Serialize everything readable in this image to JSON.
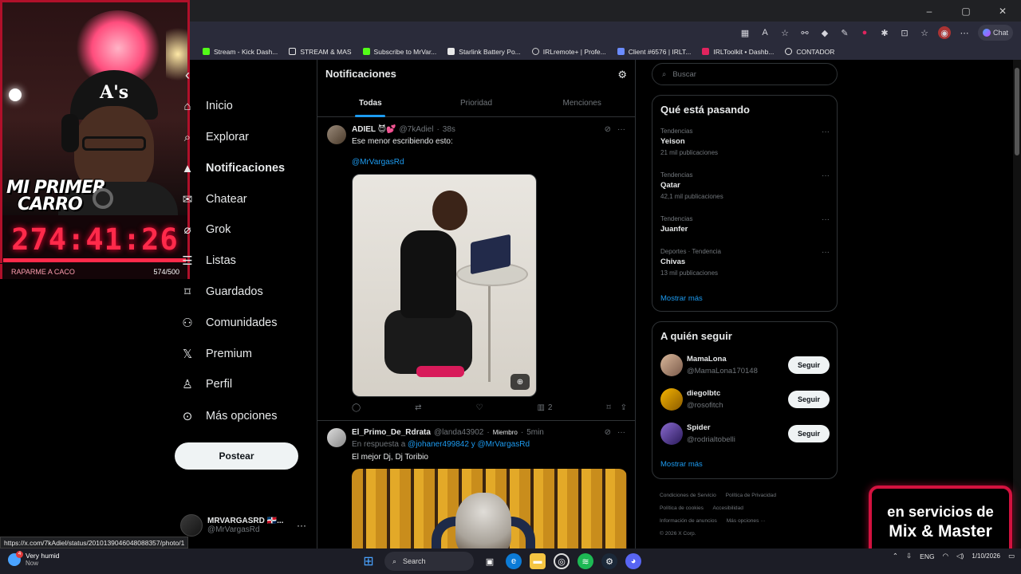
{
  "browser": {
    "window_controls": [
      "–",
      "▢",
      "✕"
    ],
    "chat_label": "Chat",
    "bookmarks": [
      {
        "label": "Stream - Kick Dash...",
        "color": "#53fc18"
      },
      {
        "label": "STREAM & MAS",
        "color": "#e8e8e8"
      },
      {
        "label": "Subscribe to MrVar...",
        "color": "#53fc18"
      },
      {
        "label": "Starlink Battery Po...",
        "color": "#e8e8e8"
      },
      {
        "label": "IRLremote+ | Profe...",
        "color": "#cfcfcf"
      },
      {
        "label": "Client #6576 | IRLT...",
        "color": "#6b8cff"
      },
      {
        "label": "IRLToolkit • Dashb...",
        "color": "#e0245e"
      },
      {
        "label": "CONTADOR",
        "color": "#e8e8e8"
      }
    ],
    "status_url": "https://x.com/7kAdiel/status/2010139046048088357/photo/1"
  },
  "stream_overlay": {
    "title_line1": "MI PRIMER",
    "title_line2": "CARRO",
    "timer": "274:41:26",
    "progress": 0.995,
    "goal_label": "RAPARME A CACO",
    "goal_count": "574/500"
  },
  "nav": {
    "items": [
      {
        "label": "Inicio",
        "icon": "home-icon",
        "active": false
      },
      {
        "label": "Explorar",
        "icon": "search-icon",
        "active": false
      },
      {
        "label": "Notificaciones",
        "icon": "bell-icon",
        "active": true
      },
      {
        "label": "Chatear",
        "icon": "envelope-icon",
        "active": false
      },
      {
        "label": "Grok",
        "icon": "grok-icon",
        "active": false
      },
      {
        "label": "Listas",
        "icon": "list-icon",
        "active": false
      },
      {
        "label": "Guardados",
        "icon": "bookmark-icon",
        "active": false
      },
      {
        "label": "Comunidades",
        "icon": "people-icon",
        "active": false
      },
      {
        "label": "Premium",
        "icon": "x-logo-icon",
        "active": false
      },
      {
        "label": "Perfil",
        "icon": "person-icon",
        "active": false
      },
      {
        "label": "Más opciones",
        "icon": "more-circle-icon",
        "active": false
      }
    ],
    "post_label": "Postear",
    "profile_name": "MRVARGASRD 🇩🇴...",
    "profile_handle": "@MrVargasRd"
  },
  "main": {
    "title": "Notificaciones",
    "tabs": [
      "Todas",
      "Prioridad",
      "Menciones"
    ],
    "tweet1": {
      "name": "ADIEL 😈💕",
      "handle": "@7kAdiel",
      "time": "38s",
      "text": "Ese menor escribiendo esto:",
      "mention": "@MrVargasRd",
      "views": "2"
    },
    "tweet2": {
      "name": "El_Primo_De_Rdrata",
      "handle": "@landa43902",
      "badge": "Miembro",
      "time": "5min",
      "reply_prefix": "En respuesta a",
      "reply_targets": "@johaner499842 y @MrVargasRd",
      "text": "El mejor Dj, Dj Toribio"
    }
  },
  "sidebar": {
    "search_placeholder": "Buscar",
    "trending_title": "Qué está pasando",
    "trends": [
      {
        "category": "Tendencias",
        "title": "Yeison",
        "count": "21 mil publicaciones"
      },
      {
        "category": "Tendencias",
        "title": "Qatar",
        "count": "42,1 mil publicaciones"
      },
      {
        "category": "Tendencias",
        "title": "Juanfer",
        "count": ""
      },
      {
        "category": "Deportes · Tendencia",
        "title": "Chivas",
        "count": "13 mil publicaciones"
      }
    ],
    "show_more": "Mostrar más",
    "who_to_follow_title": "A quién seguir",
    "follow": [
      {
        "name": "MamaLona",
        "handle": "@MamaLona170148",
        "button": "Seguir"
      },
      {
        "name": "diegolbtc",
        "handle": "@rosofitch",
        "button": "Seguir"
      },
      {
        "name": "Spider",
        "handle": "@rodrialtobelli",
        "button": "Seguir"
      }
    ],
    "footer": [
      "Condiciones de Servicio",
      "Política de Privacidad",
      "Política de cookies",
      "Accesibilidad",
      "Información de anuncios",
      "Más opciones ···",
      "© 2026 X Corp."
    ]
  },
  "promo": {
    "line1": "en servicios de",
    "line2": "Mix & Master"
  },
  "taskbar": {
    "weather_title": "Very humid",
    "weather_sub": "Now",
    "weather_badge": "4",
    "search_label": "Search",
    "lang": "ENG",
    "date": "1/10/2026"
  }
}
